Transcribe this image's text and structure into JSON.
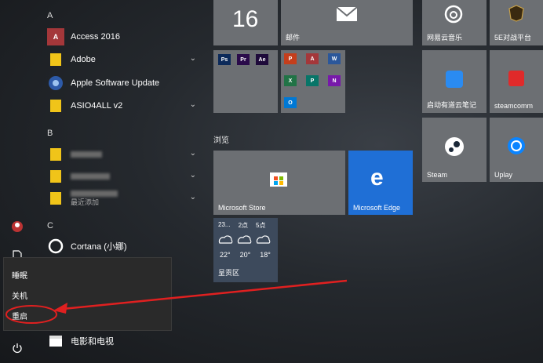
{
  "app_list": {
    "letter_a": "A",
    "letter_b": "B",
    "letter_c": "C",
    "apps": {
      "access": "Access 2016",
      "adobe": "Adobe",
      "apple_update": "Apple Software Update",
      "asio": "ASIO4ALL v2",
      "recently_added": "最近添加",
      "cortana": "Cortana (小娜)",
      "movies": "电影和电视"
    }
  },
  "power_menu": {
    "sleep": "睡眠",
    "shutdown": "关机",
    "restart": "重启"
  },
  "tiles": {
    "calendar_day": "16",
    "mail": "邮件",
    "browse_section": "浏览",
    "store": "Microsoft Store",
    "edge": "Microsoft Edge",
    "weather": {
      "temps_top": [
        "23...",
        "2点",
        "5点"
      ],
      "temps_bottom": [
        "22°",
        "20°",
        "18°"
      ],
      "location": "呈贡区"
    },
    "netease_music": "网易云音乐",
    "fivee": "5E对战平台",
    "youdao": "启动有道云笔记",
    "steamcommunity": "steamcomm",
    "steam": "Steam",
    "uplay": "Uplay"
  },
  "office_mini": {
    "ps": "Ps",
    "pr": "Pr",
    "ae": "Ae",
    "ppt": "P",
    "access": "A",
    "word": "W",
    "excel": "X",
    "publisher": "P",
    "onenote": "N",
    "outlook": "O"
  },
  "colors": {
    "tile_gray": "#6c6f73",
    "tile_edge": "#1f6fd6",
    "arrow": "#e02020",
    "access": "#a4373a",
    "word": "#2b579a",
    "excel": "#217346",
    "ppt": "#c43e1c",
    "onenote": "#7719aa",
    "outlook": "#0078d4"
  }
}
